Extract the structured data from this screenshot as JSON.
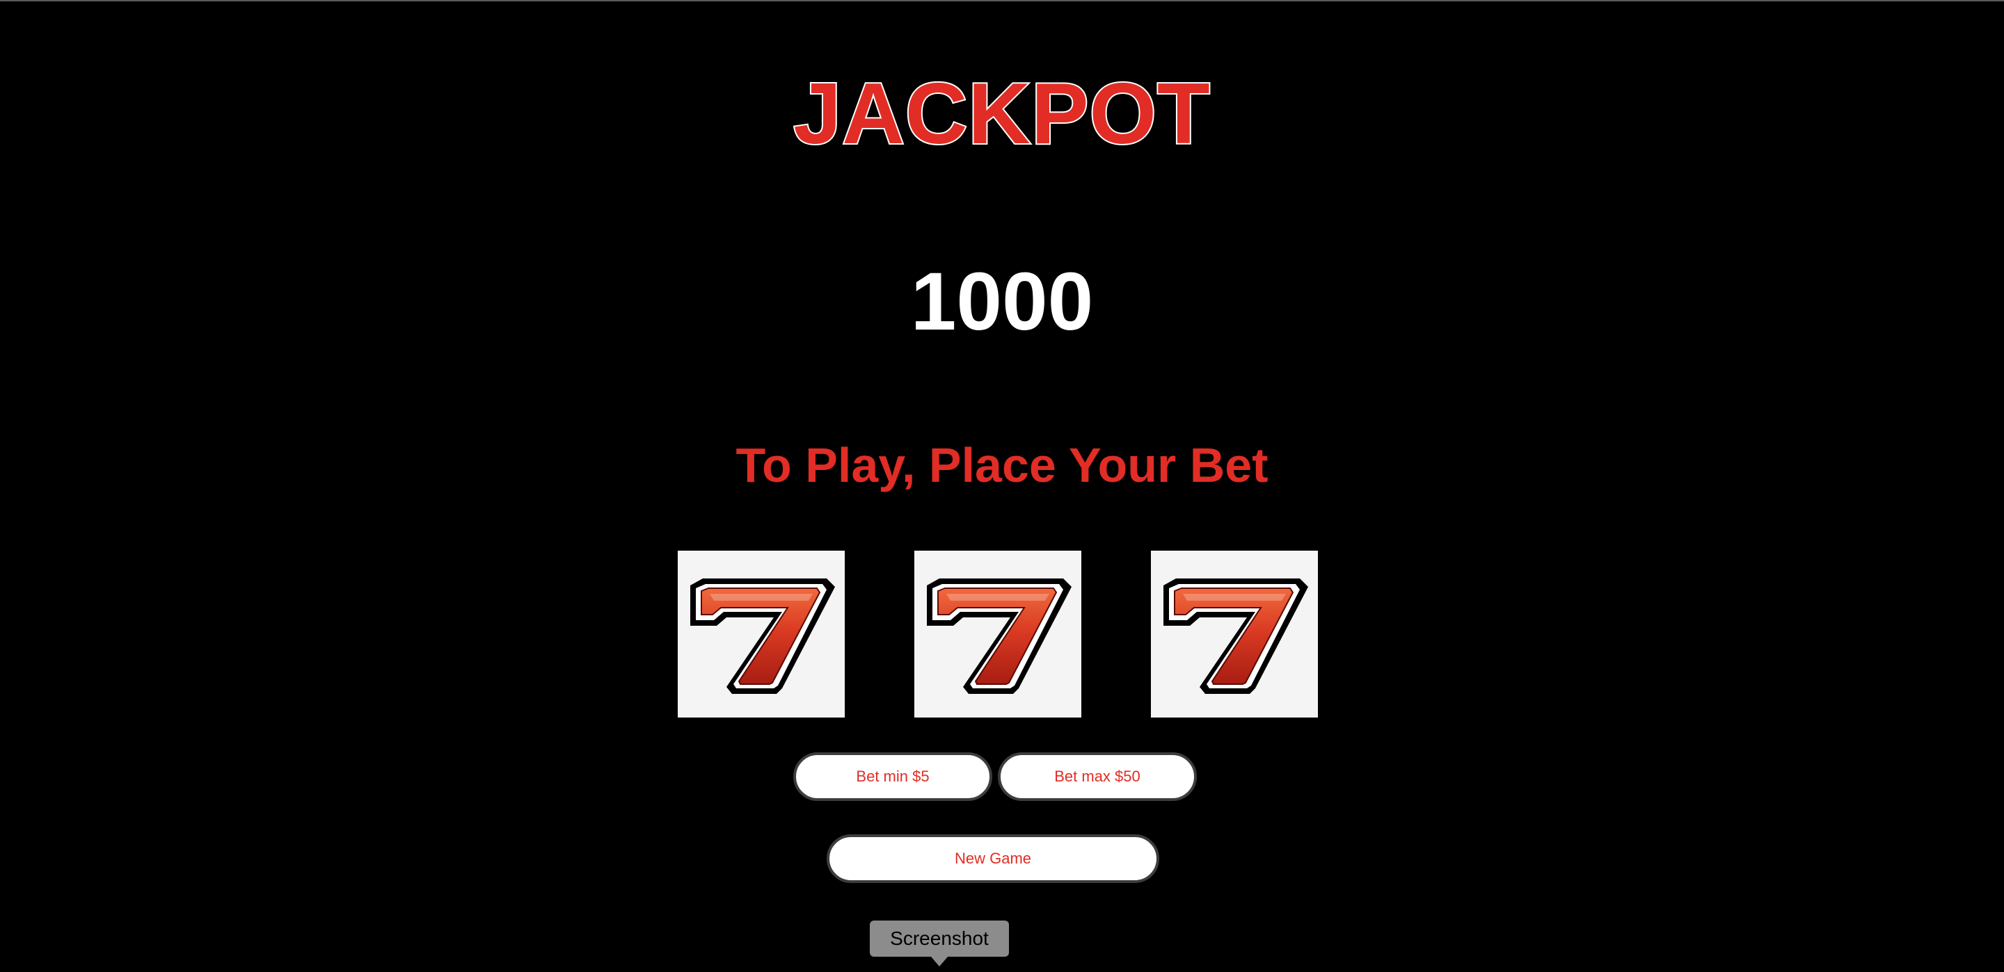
{
  "game": {
    "title": "JACKPOT",
    "credits": "1000",
    "message": "To Play, Place Your Bet"
  },
  "reels": [
    {
      "symbol": "seven",
      "glyph": "7"
    },
    {
      "symbol": "seven",
      "glyph": "7"
    },
    {
      "symbol": "seven",
      "glyph": "7"
    }
  ],
  "controls": {
    "bet_min_label": "Bet min $5",
    "bet_max_label": "Bet max $50",
    "new_game_label": "New Game"
  },
  "tooltip": {
    "label": "Screenshot"
  },
  "colors": {
    "background": "#000000",
    "accent_red": "#e12d25",
    "text_white": "#ffffff",
    "reel_bg": "#f4f4f4"
  }
}
